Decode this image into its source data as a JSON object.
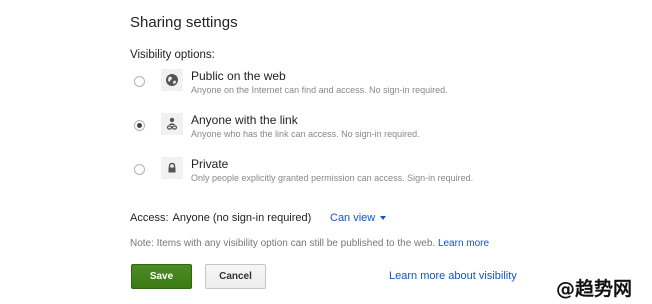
{
  "dialog": {
    "title": "Sharing settings",
    "visibility_label": "Visibility options:"
  },
  "options": [
    {
      "label": "Public on the web",
      "description": "Anyone on the Internet can find and access. No sign-in required.",
      "icon": "globe-icon",
      "selected": false
    },
    {
      "label": "Anyone with the link",
      "description": "Anyone who has the link can access. No sign-in required.",
      "icon": "link-user-icon",
      "selected": true
    },
    {
      "label": "Private",
      "description": "Only people explicitly granted permission can access. Sign-in required.",
      "icon": "lock-icon",
      "selected": false
    }
  ],
  "access": {
    "label": "Access:",
    "value": "Anyone (no sign-in required)",
    "permission": "Can view"
  },
  "note": {
    "text": "Note: Items with any visibility option can still be published to the web.",
    "link": "Learn more"
  },
  "buttons": {
    "save": "Save",
    "cancel": "Cancel"
  },
  "footer_link": "Learn more about visibility",
  "watermark": "@趋势网",
  "colors": {
    "link": "#1155cc",
    "save_button": "#3b7a14",
    "secondary_text": "#888888"
  }
}
